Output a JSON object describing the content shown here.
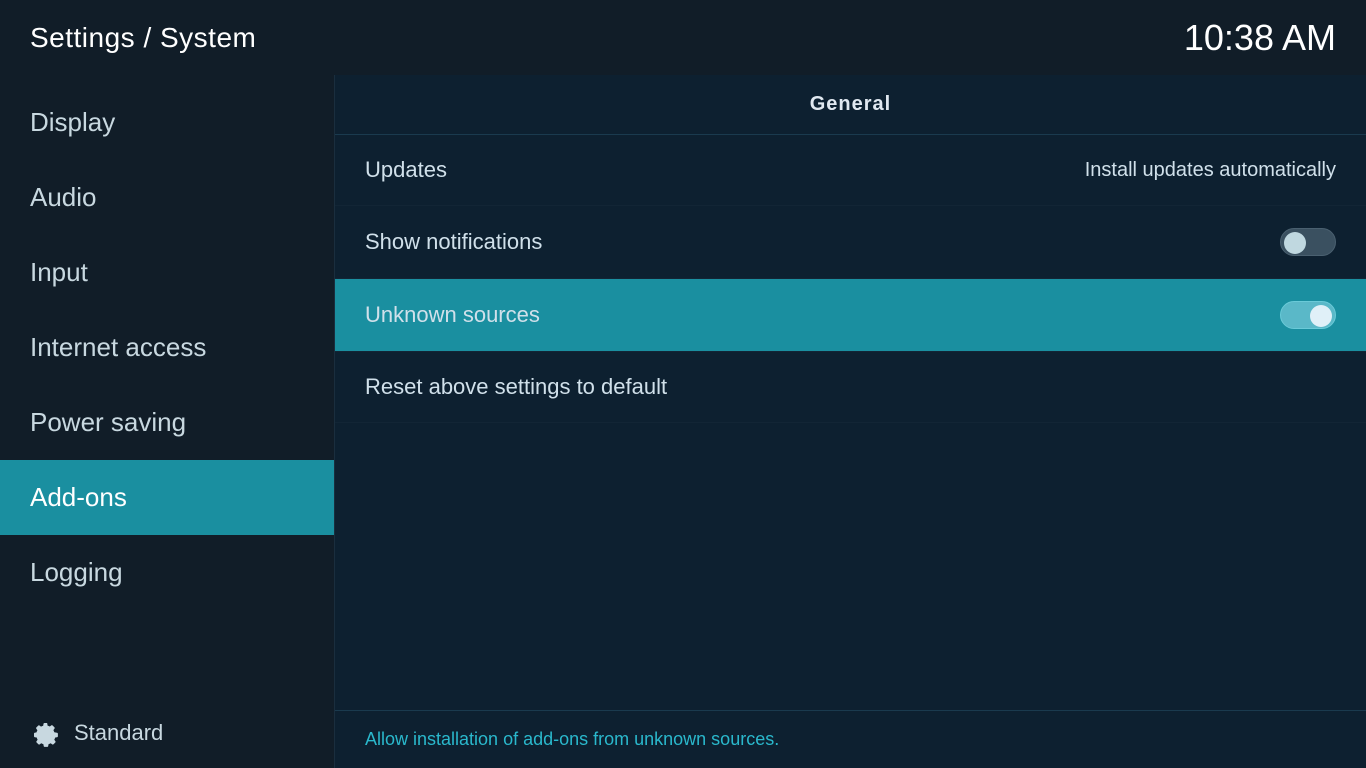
{
  "header": {
    "title": "Settings / System",
    "time": "10:38 AM"
  },
  "sidebar": {
    "items": [
      {
        "id": "display",
        "label": "Display",
        "active": false
      },
      {
        "id": "audio",
        "label": "Audio",
        "active": false
      },
      {
        "id": "input",
        "label": "Input",
        "active": false
      },
      {
        "id": "internet-access",
        "label": "Internet access",
        "active": false
      },
      {
        "id": "power-saving",
        "label": "Power saving",
        "active": false
      },
      {
        "id": "add-ons",
        "label": "Add-ons",
        "active": true
      },
      {
        "id": "logging",
        "label": "Logging",
        "active": false
      }
    ],
    "footer": {
      "label": "Standard",
      "icon": "gear-icon"
    }
  },
  "content": {
    "section_title": "General",
    "settings": [
      {
        "id": "updates",
        "label": "Updates",
        "value_text": "Install updates automatically",
        "toggle": null
      },
      {
        "id": "show-notifications",
        "label": "Show notifications",
        "value_text": null,
        "toggle": "off"
      },
      {
        "id": "unknown-sources",
        "label": "Unknown sources",
        "value_text": null,
        "toggle": "on",
        "selected": true
      },
      {
        "id": "reset-above",
        "label": "Reset above settings to default",
        "value_text": null,
        "toggle": null
      }
    ],
    "footer_hint": "Allow installation of add-ons from unknown sources."
  }
}
